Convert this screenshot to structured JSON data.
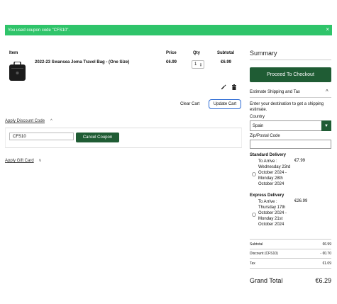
{
  "notice": {
    "text": "You used coupon code \"CFS10\".",
    "close": "×"
  },
  "cart": {
    "headers": {
      "item": "Item",
      "price": "Price",
      "qty": "Qty",
      "subtotal": "Subtotal"
    },
    "item": {
      "name": "2022-23 Swansea Joma Travel Bag - (One Size)",
      "price": "€6.99",
      "qty": "1",
      "subtotal": "€6.99"
    },
    "clear_label": "Clear Cart",
    "update_label": "Update Cart"
  },
  "discount": {
    "label": "Apply Discount Code",
    "chevron": "^",
    "coupon_value": "CFS10",
    "cancel_label": "Cancel Coupon"
  },
  "gift_card": {
    "label": "Apply Gift Card",
    "chevron": "v"
  },
  "summary": {
    "title": "Summary",
    "checkout_label": "Proceed To Checkout",
    "estimate_title": "Estimate Shipping and Tax",
    "estimate_chevron": "^",
    "estimate_desc": "Enter your destination to get a shipping estimate.",
    "country_label": "Country",
    "country_value": "Spain",
    "zip_label": "Zip/Postal Code",
    "standard": {
      "title": "Standard Delivery",
      "line1": "To Arrive :",
      "line2": "Wednesday 23rd",
      "line3": "October 2024 -",
      "line4": "Monday 28th",
      "line5": "October 2024",
      "price": "€7.99"
    },
    "express": {
      "title": "Express Delivery",
      "line1": "To Arrive :",
      "line2": "Thursday 17th",
      "line3": "October 2024 -",
      "line4": "Monday 21st",
      "line5": "October 2024",
      "price": "€26.99"
    },
    "totals": {
      "subtotal_label": "Subtotal",
      "subtotal_value": "€6.99",
      "discount_label": "Discount (CFS10)",
      "discount_value": "- €0.70",
      "tax_label": "Tax",
      "tax_value": "€1.09"
    },
    "grand_label": "Grand Total",
    "grand_value": "€6.29"
  },
  "colors": {
    "notice_bg": "#2fc46a",
    "primary_green": "#1f5c34",
    "update_border": "#2d6bd4"
  }
}
